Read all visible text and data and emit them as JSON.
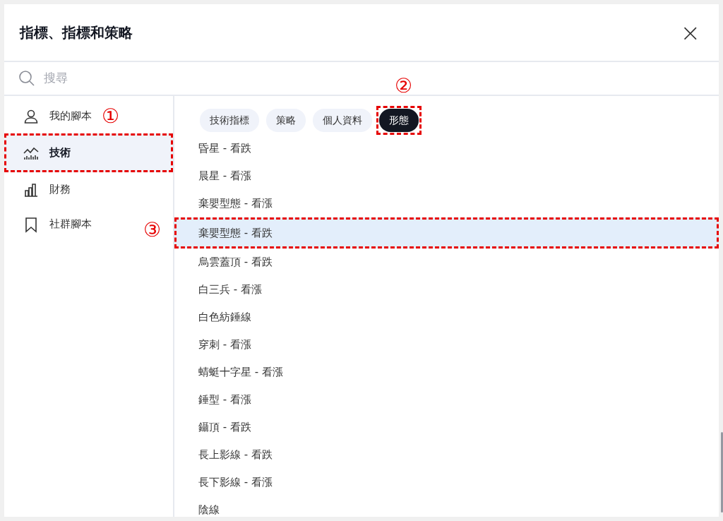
{
  "dialog": {
    "title": "指標、指標和策略",
    "close": "×"
  },
  "search": {
    "placeholder": "搜尋"
  },
  "sidebar": {
    "items": [
      {
        "label": "我的腳本",
        "kind": "person",
        "selected": false,
        "outlined": false,
        "callout": "①"
      },
      {
        "label": "技術",
        "kind": "chart",
        "selected": true,
        "outlined": true
      },
      {
        "label": "財務",
        "kind": "bars",
        "selected": false,
        "outlined": false
      },
      {
        "label": "社群腳本",
        "kind": "bookmark",
        "selected": false,
        "outlined": false
      }
    ]
  },
  "filters": [
    {
      "label": "技術指標",
      "selected": false,
      "outlined": false
    },
    {
      "label": "策略",
      "selected": false,
      "outlined": false
    },
    {
      "label": "個人資料",
      "selected": false,
      "outlined": false
    },
    {
      "label": "形態",
      "selected": true,
      "outlined": true,
      "callout": "②"
    }
  ],
  "patterns": [
    {
      "label": "昏星 - 看跌",
      "selected": false,
      "outlined": false
    },
    {
      "label": "晨星 - 看漲",
      "selected": false,
      "outlined": false
    },
    {
      "label": "棄嬰型態 - 看漲",
      "selected": false,
      "outlined": false
    },
    {
      "label": "棄嬰型態 - 看跌",
      "selected": true,
      "outlined": true,
      "callout": "③"
    },
    {
      "label": "烏雲蓋頂 - 看跌",
      "selected": false,
      "outlined": false
    },
    {
      "label": "白三兵 - 看漲",
      "selected": false,
      "outlined": false
    },
    {
      "label": "白色紡錘線",
      "selected": false,
      "outlined": false
    },
    {
      "label": "穿刺 - 看漲",
      "selected": false,
      "outlined": false
    },
    {
      "label": "蜻蜓十字星 - 看漲",
      "selected": false,
      "outlined": false
    },
    {
      "label": "錘型 - 看漲",
      "selected": false,
      "outlined": false
    },
    {
      "label": "鑷頂 - 看跌",
      "selected": false,
      "outlined": false
    },
    {
      "label": "長上影線 - 看跌",
      "selected": false,
      "outlined": false
    },
    {
      "label": "長下影線 - 看漲",
      "selected": false,
      "outlined": false
    },
    {
      "label": "陰線",
      "selected": false,
      "outlined": false
    }
  ]
}
